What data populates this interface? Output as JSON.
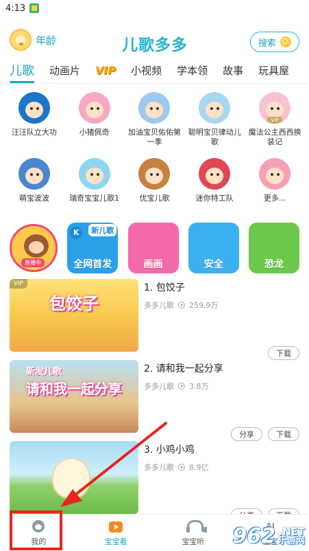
{
  "status_bar": {
    "time": "4:13"
  },
  "header": {
    "age_label": "年龄",
    "logo_text": "儿歌多多",
    "search_label": "搜索"
  },
  "tabs": [
    {
      "label": "儿歌",
      "active": true
    },
    {
      "label": "动画片"
    },
    {
      "label": "VIP"
    },
    {
      "label": "小视频"
    },
    {
      "label": "学本领"
    },
    {
      "label": "故事"
    },
    {
      "label": "玩具屋"
    }
  ],
  "characters": [
    {
      "label": "汪汪队立大功",
      "color": "#1b75c9"
    },
    {
      "label": "小猪佩奇",
      "color": "#f7a9c4"
    },
    {
      "label": "加油宝贝佑佑第一季",
      "color": "#9ec9ee"
    },
    {
      "label": "聪明宝贝律动儿歌",
      "color": "#a8d7f2"
    },
    {
      "label": "魔法公主西西换装记",
      "color": "#f6c3d5",
      "vip": "VIP"
    },
    {
      "label": "萌宝波波",
      "color": "#4a86d1"
    },
    {
      "label": "瑞奇宝宝儿歌1",
      "color": "#8ed6f0"
    },
    {
      "label": "优宝儿歌",
      "color": "#c5813f"
    },
    {
      "label": "迷你特工队",
      "color": "#e14856"
    },
    {
      "label": "更多...",
      "color": "#f7a1b5"
    }
  ],
  "banners": [
    {
      "label": "",
      "live_tag": "直播中",
      "color": "#ffc94d"
    },
    {
      "label": "全网首发",
      "new_tag": "新儿歌",
      "color": "#2aa0e8"
    },
    {
      "label": "画画",
      "color": "#f46aa9"
    },
    {
      "label": "安全",
      "color": "#3db0f0"
    },
    {
      "label": "恐龙",
      "color": "#6cc84a"
    }
  ],
  "songs": [
    {
      "title": "1. 包饺子",
      "author": "多多儿歌",
      "plays": "259.9万",
      "thumb_text": "包饺子",
      "vip": "VIP",
      "actions": [
        "下载"
      ]
    },
    {
      "title": "2. 请和我一起分享",
      "author": "多多儿歌",
      "plays": "3.8万",
      "thumb_text": "请和我一起分享",
      "thumb_sub": "新发儿歌",
      "actions": [
        "分享",
        "下载"
      ]
    },
    {
      "title": "3. 小鸡小鸡",
      "author": "多多儿歌",
      "plays": "8.9亿",
      "actions": [
        "分享",
        "下载"
      ]
    }
  ],
  "bottom_nav": [
    {
      "label": "我的",
      "icon": "me-icon"
    },
    {
      "label": "宝宝看",
      "icon": "tv-icon",
      "active": true
    },
    {
      "label": "宝宝听",
      "icon": "headphones-icon"
    },
    {
      "label": "宝宝",
      "icon": "ai-icon"
    }
  ],
  "watermark": {
    "number": "962",
    "net": ".NET",
    "cn": "乐游网"
  },
  "colors": {
    "accent": "#1aa9c2",
    "annotation_red": "#e8251d"
  }
}
